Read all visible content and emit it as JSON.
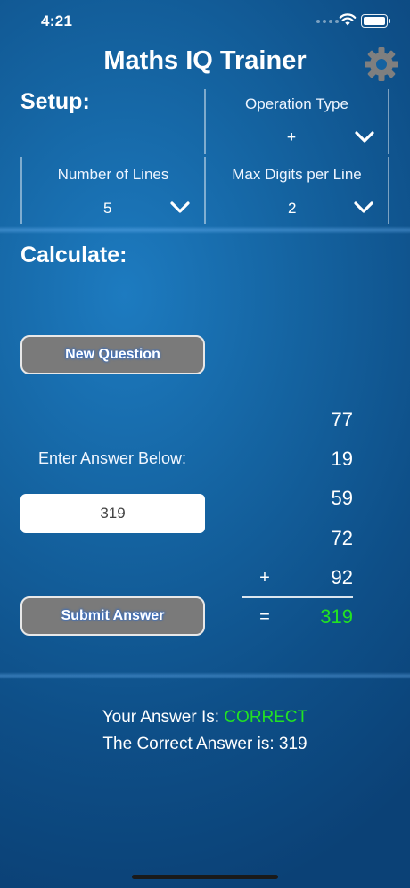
{
  "status_bar": {
    "time": "4:21"
  },
  "header": {
    "title": "Maths IQ Trainer",
    "settings_icon": "gear-icon"
  },
  "setup": {
    "label": "Setup:",
    "operation_type": {
      "title": "Operation Type",
      "value": "+"
    },
    "number_of_lines": {
      "title": "Number of Lines",
      "value": "5"
    },
    "max_digits": {
      "title": "Max Digits per Line",
      "value": "2"
    }
  },
  "calculate": {
    "label": "Calculate:",
    "new_question_label": "New Question",
    "enter_answer_label": "Enter Answer Below:",
    "answer_value": "319",
    "submit_label": "Submit Answer",
    "numbers": [
      "77",
      "19",
      "59",
      "72",
      "92"
    ],
    "operator": "+",
    "equals": "=",
    "total": "319"
  },
  "result": {
    "your_answer_prefix": "Your Answer Is: ",
    "your_answer_status": "CORRECT",
    "correct_answer_text": "The Correct Answer is: 319"
  },
  "colors": {
    "correct": "#22e322",
    "button_bg": "#7a7a7a"
  }
}
